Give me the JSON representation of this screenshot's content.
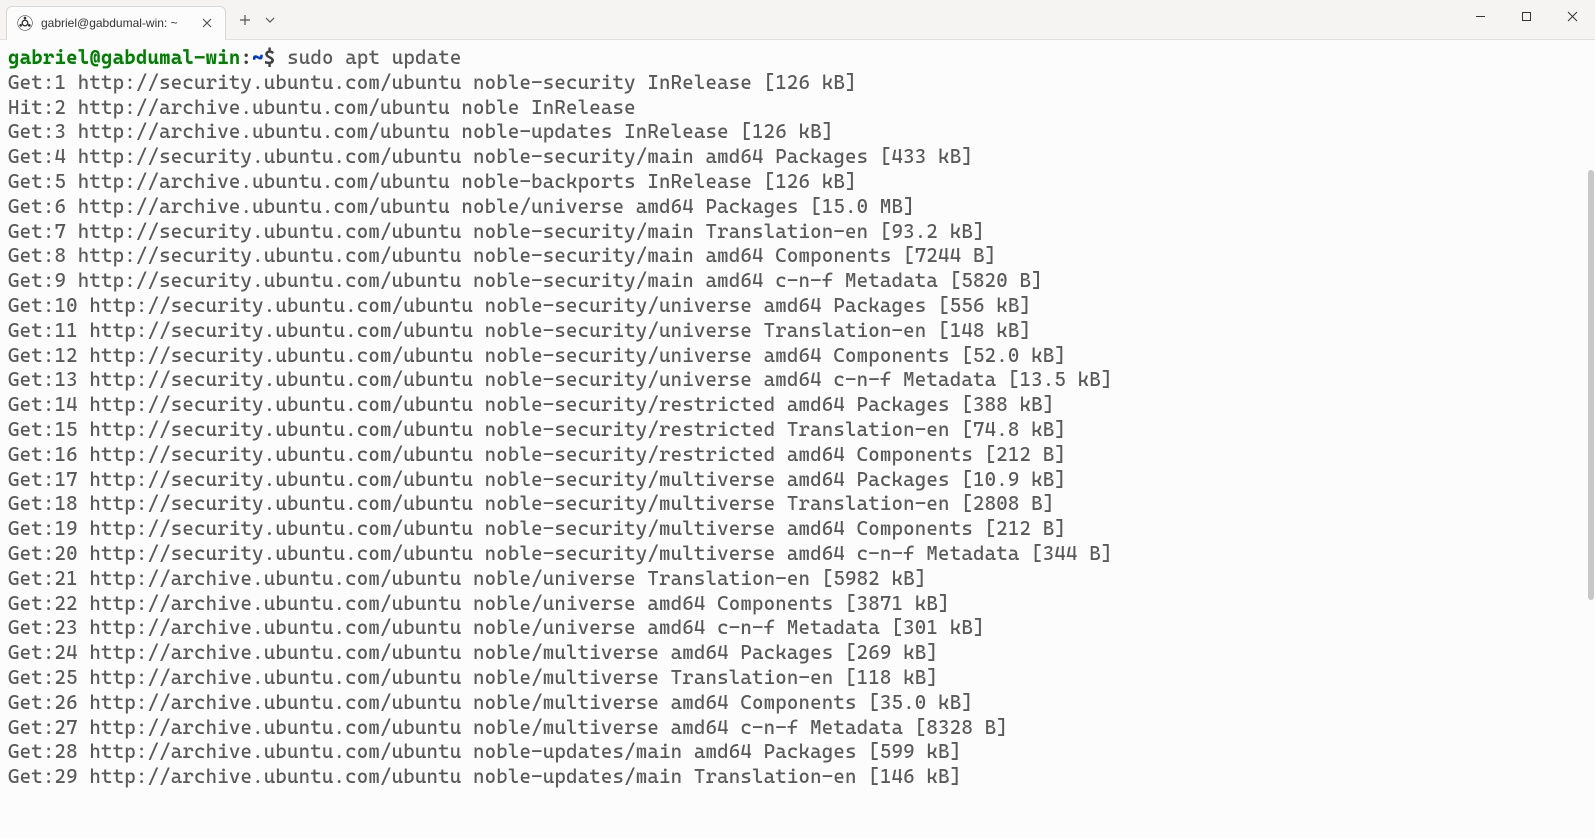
{
  "tab": {
    "title": "gabriel@gabdumal-win: ~"
  },
  "prompt": {
    "user_host": "gabriel@gabdumal-win",
    "path": "~",
    "command": "sudo apt update"
  },
  "output_lines": [
    "Get:1 http://security.ubuntu.com/ubuntu noble-security InRelease [126 kB]",
    "Hit:2 http://archive.ubuntu.com/ubuntu noble InRelease",
    "Get:3 http://archive.ubuntu.com/ubuntu noble-updates InRelease [126 kB]",
    "Get:4 http://security.ubuntu.com/ubuntu noble-security/main amd64 Packages [433 kB]",
    "Get:5 http://archive.ubuntu.com/ubuntu noble-backports InRelease [126 kB]",
    "Get:6 http://archive.ubuntu.com/ubuntu noble/universe amd64 Packages [15.0 MB]",
    "Get:7 http://security.ubuntu.com/ubuntu noble-security/main Translation-en [93.2 kB]",
    "Get:8 http://security.ubuntu.com/ubuntu noble-security/main amd64 Components [7244 B]",
    "Get:9 http://security.ubuntu.com/ubuntu noble-security/main amd64 c-n-f Metadata [5820 B]",
    "Get:10 http://security.ubuntu.com/ubuntu noble-security/universe amd64 Packages [556 kB]",
    "Get:11 http://security.ubuntu.com/ubuntu noble-security/universe Translation-en [148 kB]",
    "Get:12 http://security.ubuntu.com/ubuntu noble-security/universe amd64 Components [52.0 kB]",
    "Get:13 http://security.ubuntu.com/ubuntu noble-security/universe amd64 c-n-f Metadata [13.5 kB]",
    "Get:14 http://security.ubuntu.com/ubuntu noble-security/restricted amd64 Packages [388 kB]",
    "Get:15 http://security.ubuntu.com/ubuntu noble-security/restricted Translation-en [74.8 kB]",
    "Get:16 http://security.ubuntu.com/ubuntu noble-security/restricted amd64 Components [212 B]",
    "Get:17 http://security.ubuntu.com/ubuntu noble-security/multiverse amd64 Packages [10.9 kB]",
    "Get:18 http://security.ubuntu.com/ubuntu noble-security/multiverse Translation-en [2808 B]",
    "Get:19 http://security.ubuntu.com/ubuntu noble-security/multiverse amd64 Components [212 B]",
    "Get:20 http://security.ubuntu.com/ubuntu noble-security/multiverse amd64 c-n-f Metadata [344 B]",
    "Get:21 http://archive.ubuntu.com/ubuntu noble/universe Translation-en [5982 kB]",
    "Get:22 http://archive.ubuntu.com/ubuntu noble/universe amd64 Components [3871 kB]",
    "Get:23 http://archive.ubuntu.com/ubuntu noble/universe amd64 c-n-f Metadata [301 kB]",
    "Get:24 http://archive.ubuntu.com/ubuntu noble/multiverse amd64 Packages [269 kB]",
    "Get:25 http://archive.ubuntu.com/ubuntu noble/multiverse Translation-en [118 kB]",
    "Get:26 http://archive.ubuntu.com/ubuntu noble/multiverse amd64 Components [35.0 kB]",
    "Get:27 http://archive.ubuntu.com/ubuntu noble/multiverse amd64 c-n-f Metadata [8328 B]",
    "Get:28 http://archive.ubuntu.com/ubuntu noble-updates/main amd64 Packages [599 kB]",
    "Get:29 http://archive.ubuntu.com/ubuntu noble-updates/main Translation-en [146 kB]"
  ]
}
